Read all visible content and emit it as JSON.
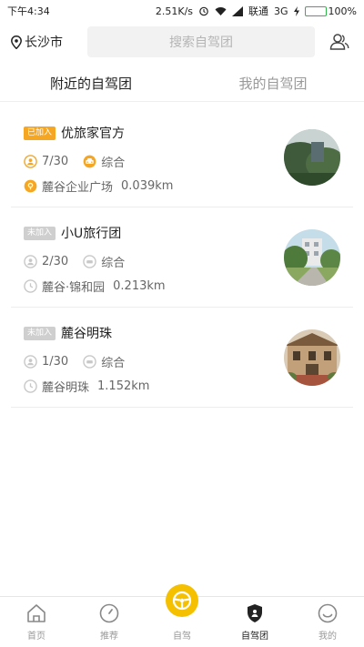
{
  "status_bar": {
    "time": "下午4:34",
    "speed": "2.51K/s",
    "carrier": "联通",
    "network": "3G",
    "battery": "100%",
    "battery_level": 1.0
  },
  "header": {
    "city": "长沙市",
    "search_placeholder": "搜索自驾团"
  },
  "tabs": [
    {
      "label": "附近的自驾团",
      "active": true
    },
    {
      "label": "我的自驾团",
      "active": false
    }
  ],
  "groups": [
    {
      "status": "已加入",
      "joined": true,
      "name": "优旅家官方",
      "members": "7/30",
      "type": "综合",
      "location": "麓谷企业广场",
      "distance": "0.039km"
    },
    {
      "status": "未加入",
      "joined": false,
      "name": "小U旅行团",
      "members": "2/30",
      "type": "综合",
      "location": "麓谷·锦和园",
      "distance": "0.213km"
    },
    {
      "status": "未加入",
      "joined": false,
      "name": "麓谷明珠",
      "members": "1/30",
      "type": "综合",
      "location": "麓谷明珠",
      "distance": "1.152km"
    }
  ],
  "bottom_nav": [
    {
      "label": "首页",
      "icon": "home-icon"
    },
    {
      "label": "推荐",
      "icon": "compass-icon"
    },
    {
      "label": "自驾",
      "icon": "steering-wheel-icon"
    },
    {
      "label": "自驾团",
      "icon": "shield-icon",
      "active": true
    },
    {
      "label": "我的",
      "icon": "smile-icon"
    }
  ],
  "colors": {
    "accent": "#f5a623",
    "fab": "#f5c000",
    "inactive": "#999999",
    "muted_icon": "#c8c8c8"
  }
}
